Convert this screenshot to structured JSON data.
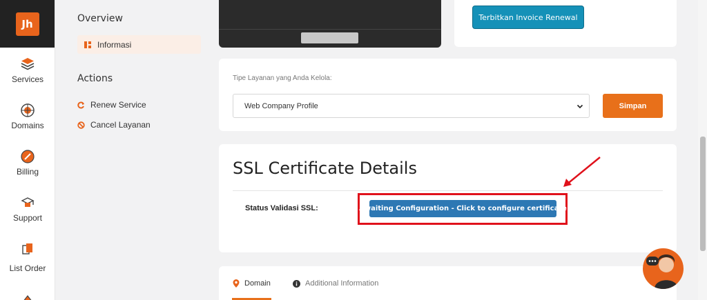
{
  "app": {
    "logo_text": "Jh",
    "accent": "#e8641c"
  },
  "nav": {
    "items": [
      {
        "label": "Services",
        "icon": "services-icon"
      },
      {
        "label": "Domains",
        "icon": "domains-icon"
      },
      {
        "label": "Billing",
        "icon": "billing-icon"
      },
      {
        "label": "Support",
        "icon": "support-icon"
      },
      {
        "label": "List Order",
        "icon": "list-order-icon"
      }
    ]
  },
  "subnav": {
    "overview_title": "Overview",
    "active_item": "Informasi",
    "actions_title": "Actions",
    "actions": [
      "Renew Service",
      "Cancel Layanan"
    ]
  },
  "invoice": {
    "button_label": "Terbitkan Invoice Renewal"
  },
  "service_type": {
    "label": "Tipe Layanan yang Anda Kelola:",
    "selected": "Web Company Profile",
    "save_label": "Simpan"
  },
  "ssl": {
    "title": "SSL Certificate Details",
    "status_label": "Status Validasi SSL:",
    "status_button": "Awaiting Configuration - Click to configure certificate"
  },
  "tabs": [
    {
      "label": "Domain",
      "icon": "location-pin-icon"
    },
    {
      "label": "Additional Information",
      "icon": "info-icon"
    }
  ]
}
